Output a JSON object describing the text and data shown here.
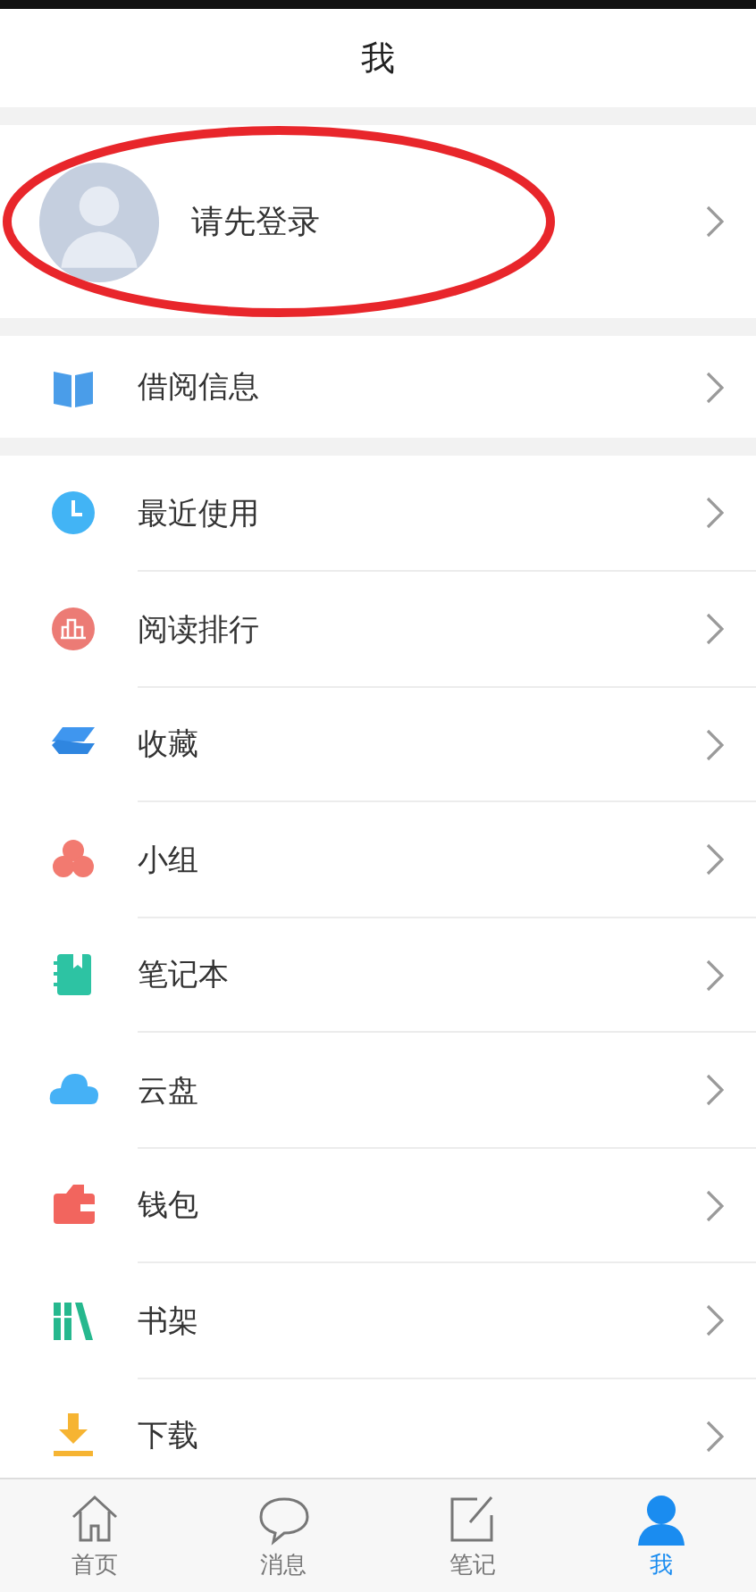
{
  "header": {
    "title": "我"
  },
  "profile": {
    "label": "请先登录"
  },
  "sections": [
    [
      {
        "label": "借阅信息"
      }
    ],
    [
      {
        "label": "最近使用"
      },
      {
        "label": "阅读排行"
      },
      {
        "label": "收藏"
      },
      {
        "label": "小组"
      },
      {
        "label": "笔记本"
      },
      {
        "label": "云盘"
      },
      {
        "label": "钱包"
      },
      {
        "label": "书架"
      },
      {
        "label": "下载"
      }
    ]
  ],
  "tab_bar": [
    {
      "label": "首页",
      "selected": false
    },
    {
      "label": "消息",
      "selected": false
    },
    {
      "label": "笔记",
      "selected": false
    },
    {
      "label": "我",
      "selected": true
    }
  ]
}
